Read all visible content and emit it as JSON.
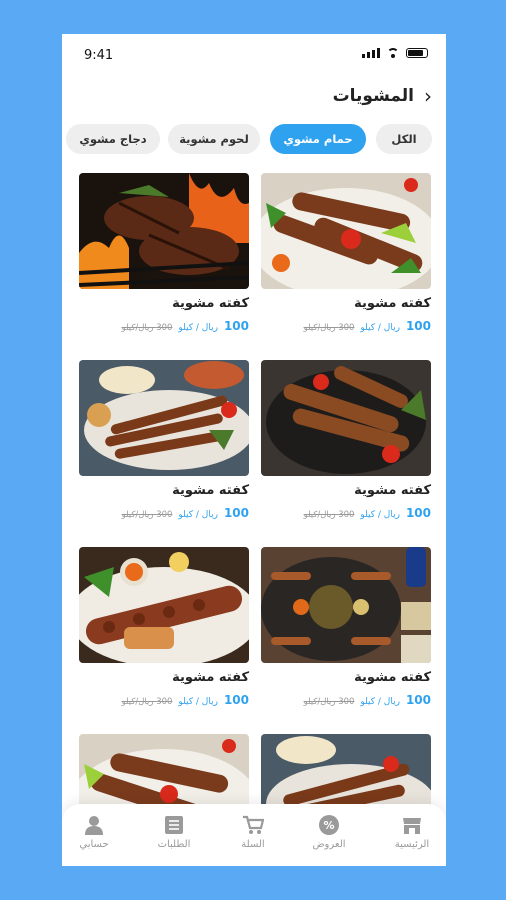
{
  "status_bar": {
    "time": "9:41"
  },
  "header": {
    "title": "المشويات",
    "back_icon": "chevron-left-icon"
  },
  "filters": [
    {
      "label": "الكل",
      "active": false
    },
    {
      "label": "حمام مشوي",
      "active": true
    },
    {
      "label": "لحوم مشوية",
      "active": false
    },
    {
      "label": "دجاج مشوي",
      "active": false
    }
  ],
  "products": [
    {
      "name": "كفته مشوية",
      "price": "100",
      "unit": "ريال / كيلو",
      "old_price": "300 ريال/كيلو",
      "image": "grilled-kofta-platter"
    },
    {
      "name": "كفته مشوية",
      "price": "100",
      "unit": "ريال / كيلو",
      "old_price": "300 ريال/كيلو",
      "image": "grilled-steak"
    },
    {
      "name": "كفته مشوية",
      "price": "100",
      "unit": "ريال / كيلو",
      "old_price": "300 ريال/كيلو",
      "image": "kofta-skewers-on-grill"
    },
    {
      "name": "كفته مشوية",
      "price": "100",
      "unit": "ريال / كيلو",
      "old_price": "300 ريال/كيلو",
      "image": "mixed-grill-platter"
    },
    {
      "name": "كفته مشوية",
      "price": "100",
      "unit": "ريال / كيلو",
      "old_price": "300 ريال/كيلو",
      "image": "mixed-grill-feast"
    },
    {
      "name": "كفته مشوية",
      "price": "100",
      "unit": "ريال / كيلو",
      "old_price": "300 ريال/كيلو",
      "image": "kebab-with-onion"
    },
    {
      "name": "",
      "price": "",
      "unit": "",
      "old_price": "",
      "image": "grilled-kofta-platter"
    },
    {
      "name": "",
      "price": "",
      "unit": "",
      "old_price": "",
      "image": "mixed-grill-platter"
    }
  ],
  "bottom_nav": [
    {
      "label": "الرئيسية",
      "icon": "store-icon",
      "active": false
    },
    {
      "label": "العروض",
      "icon": "percent-icon",
      "active": false
    },
    {
      "label": "السلة",
      "icon": "cart-icon",
      "active": false
    },
    {
      "label": "الطلبات",
      "icon": "orders-icon",
      "active": false
    },
    {
      "label": "حسابي",
      "icon": "user-icon",
      "active": false
    }
  ],
  "colors": {
    "background": "#5aa9f5",
    "accent": "#2fa2ef",
    "chip_bg": "#eeeeee"
  }
}
